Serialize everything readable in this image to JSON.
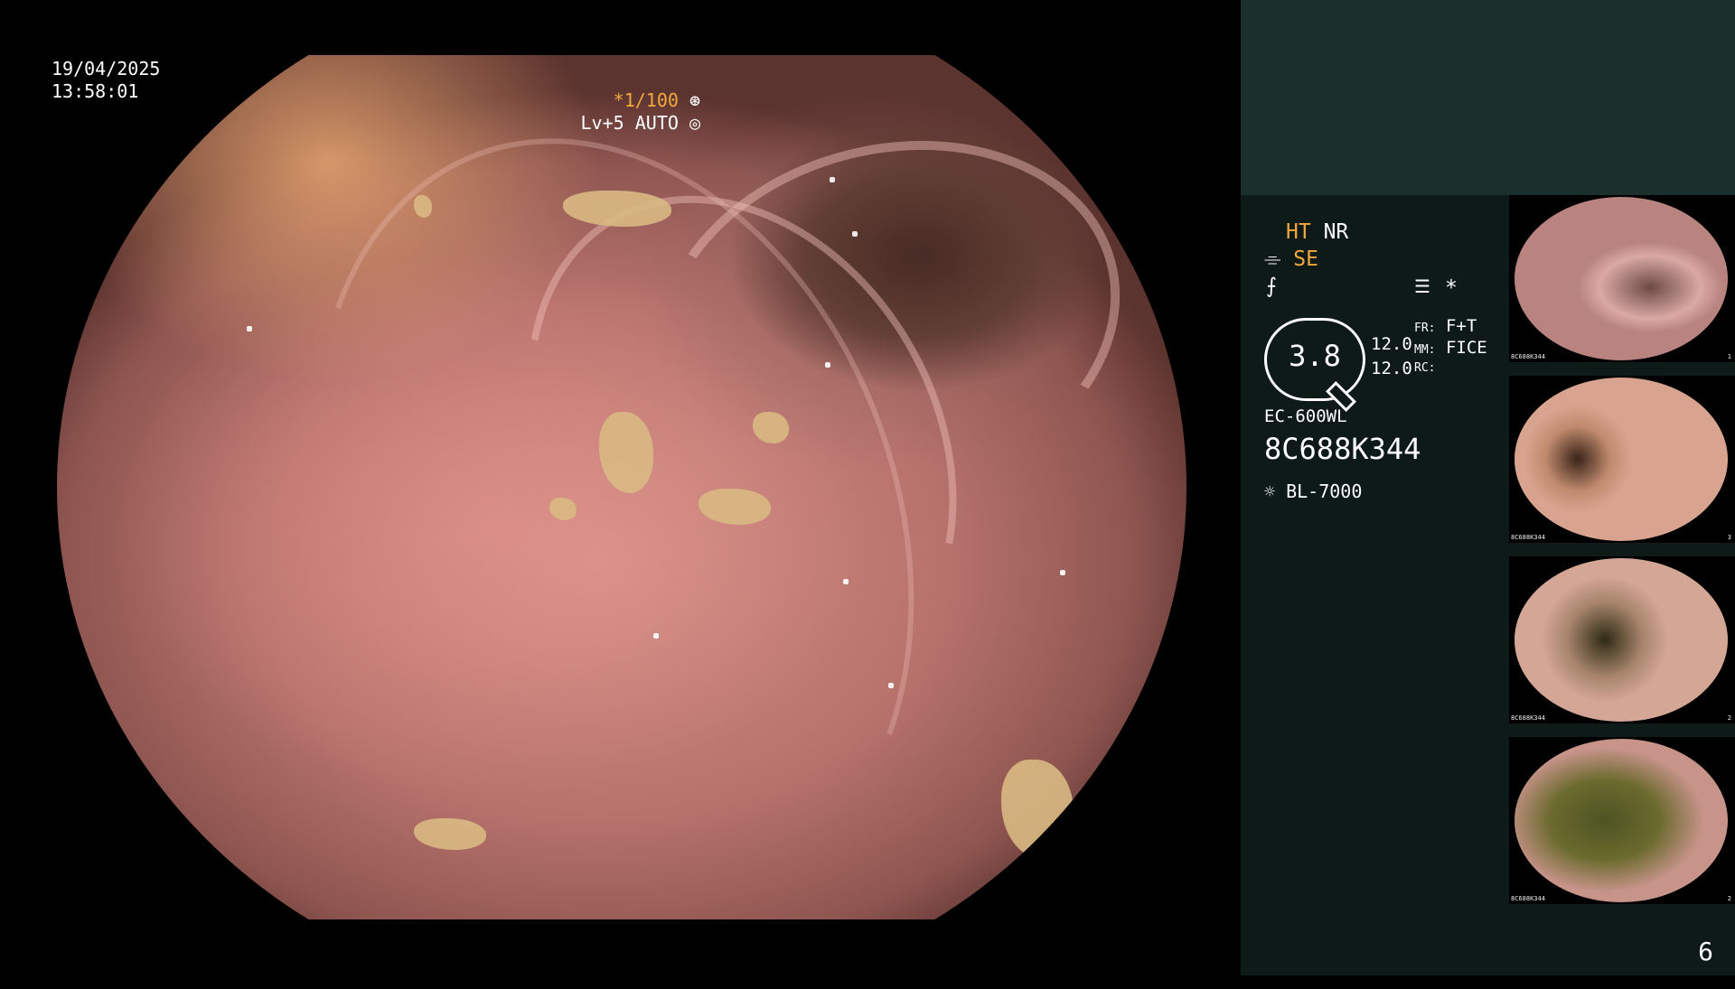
{
  "live_view": {
    "date": "19/04/2025",
    "time": "13:58:01",
    "shutter_speed": "*1/100",
    "level": "Lv+5",
    "mode": "AUTO"
  },
  "info_panel": {
    "ht": "HT",
    "nr": "NR",
    "se": "SE",
    "zoom_value": "3.8",
    "value_1": "12.0",
    "value_2": "12.0",
    "fr_label": "FR:",
    "fr_value": "F+T",
    "mm_label": "MM:",
    "mm_value": "FICE",
    "rc_label": "RC:",
    "scope_model": "EC-600WL",
    "serial": "8C688K344",
    "light_source": "BL-7000",
    "asterisk": "*"
  },
  "thumbnails": [
    {
      "serial": "8C688K344",
      "index": "1"
    },
    {
      "serial": "8C688K344",
      "index": "3"
    },
    {
      "serial": "8C688K344",
      "index": "2"
    },
    {
      "serial": "8C688K344",
      "index": "2"
    }
  ],
  "page_number": "6",
  "colors": {
    "panel_bg": "#0d1a18",
    "panel_header_bg": "#1b302c",
    "accent_orange": "#f2a93b"
  }
}
